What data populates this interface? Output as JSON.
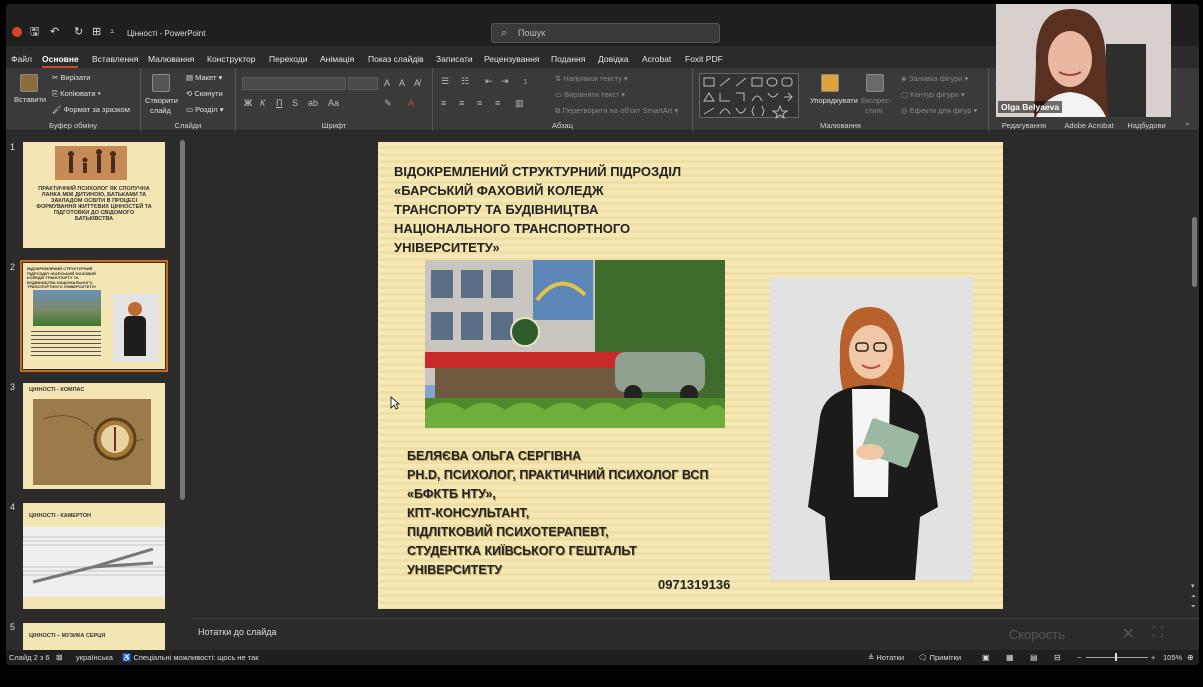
{
  "window": {
    "title": "Цінності  -  PowerPoint",
    "search_placeholder": "Пошук"
  },
  "menu": {
    "items": [
      "Файл",
      "Основне",
      "Вставлення",
      "Малювання",
      "Конструктор",
      "Переходи",
      "Анімація",
      "Показ слайдів",
      "Записати",
      "Рецензування",
      "Подання",
      "Довідка",
      "Acrobat",
      "Foxit PDF"
    ],
    "active": "Основне"
  },
  "ribbon": {
    "clipboard": {
      "label": "Буфер обміну",
      "paste": "Вставити",
      "cut": "Вирізати",
      "copy": "Копіювати",
      "format": "Формат за зразком"
    },
    "slides": {
      "label": "Слайди",
      "new": "Створити",
      "new2": "слайд",
      "layout": "Макет",
      "reset": "Скинути",
      "section": "Розділ"
    },
    "font": {
      "label": "Шрифт",
      "bold": "Ж",
      "italic": "К",
      "underline": "П",
      "strike": "S"
    },
    "paragraph": {
      "label": "Абзац",
      "direction": "Напрямок тексту",
      "align": "Вирівняти текст",
      "smartart": "Перетворити на об'єкт SmartArt"
    },
    "drawing": {
      "label": "Малювання",
      "arrange": "Упорядкувати",
      "styles1": "Експрес-",
      "styles2": "стилі",
      "fill": "Заливка фігури",
      "outline": "Контур фігури",
      "effects": "Ефекти для фігур"
    },
    "editing": {
      "label": "Редагування"
    },
    "acrobat": {
      "label": "Adobe Acrobat"
    },
    "addins": {
      "label": "Надбудови"
    }
  },
  "thumbnails": [
    {
      "num": "1",
      "title": "ПРАКТИЧНИЙ ПСИХОЛОГ ЯК СПОЛУЧНА ЛАНКА МІЖ ДИТИНОЮ, БАТЬКАМИ ТА ЗАКЛАДОМ ОСВІТИ В ПРОЦЕСІ ФОРМУВАННЯ ЖИТТЄВИХ ЦІННОСТЕЙ ТА ПІДГОТОВКИ ДО СВІДОМОГО БАТЬКІВСТВА"
    },
    {
      "num": "2",
      "title": "ВІДОКРЕМЛЕНИЙ СТРУКТУРНИЙ ПІДРОЗДІЛ «БАРСЬКИЙ ФАХОВИЙ КОЛЕДЖ ТРАНСПОРТУ ТА БУДІВНИЦТВА НАЦІОНАЛЬНОГО ТРАНСПОРТНОГО УНІВЕРСИТЕТУ»"
    },
    {
      "num": "3",
      "title": "ЦІННОСТІ - КОМПАС"
    },
    {
      "num": "4",
      "title": "ЦІННОСТІ - КАМЕРТОН"
    },
    {
      "num": "5",
      "title": "ЦІННОСТІ – МУЗИКА СЕРЦЯ"
    }
  ],
  "slide": {
    "title_lines": [
      "ВІДОКРЕМЛЕНИЙ СТРУКТУРНИЙ ПІДРОЗДІЛ",
      "«БАРСЬКИЙ ФАХОВИЙ КОЛЕДЖ",
      "ТРАНСПОРТУ ТА БУДІВНИЦТВА",
      "НАЦІОНАЛЬНОГО ТРАНСПОРТНОГО",
      "УНІВЕРСИТЕТУ»"
    ],
    "info_lines": [
      "БЕЛЯЄВА ОЛЬГА СЕРГІВНА",
      "PH.D, ПСИХОЛОГ, ПРАКТИЧНИЙ ПСИХОЛОГ ВСП",
      "«БФКТБ НТУ»,",
      "КПТ-КОНСУЛЬТАНТ,",
      "ПІДЛІТКОВИЙ ПСИХОТЕРАПЕВТ,",
      "СТУДЕНТКА КИЇВСЬКОГО ГЕШТАЛЬТ",
      "УНІВЕРСИТЕТУ"
    ],
    "phone": "0971319136"
  },
  "notes": {
    "placeholder": "Нотатки до слайда",
    "overlay": "Скорость"
  },
  "status": {
    "slide_counter": "Слайд 2 з 6",
    "language": "українська",
    "accessibility": "Спеціальні можливості: щось не так",
    "notes_btn": "Нотатки",
    "comments_btn": "Примітки",
    "zoom": "105%"
  },
  "webcam": {
    "name": "Olga Belyaeva"
  }
}
